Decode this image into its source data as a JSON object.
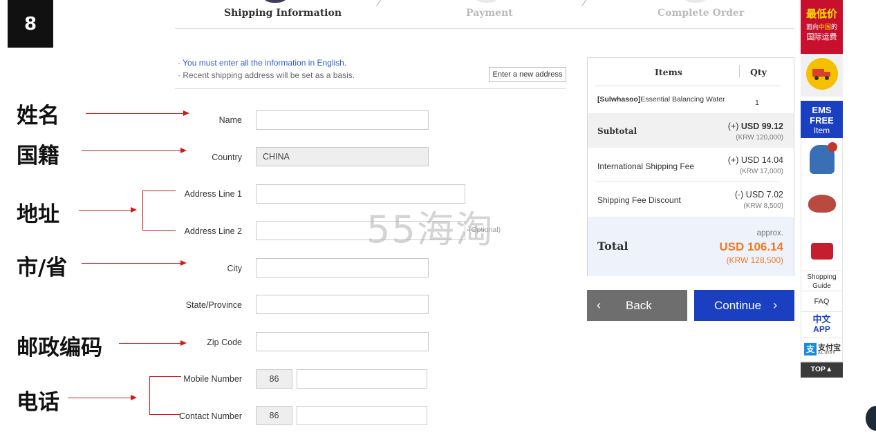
{
  "badge": "8",
  "steps": [
    "Shipping Information",
    "Payment",
    "Complete Order"
  ],
  "notes": {
    "english": "· You must enter all the information in English.",
    "recent": "· Recent shipping address will be set as a basis."
  },
  "new_address_label": "Enter a new address",
  "form": {
    "name_label": "Name",
    "country_label": "Country",
    "country_value": "CHINA",
    "address1_label": "Address Line 1",
    "address2_label": "Address Line 2",
    "optional": "(Optional)",
    "city_label": "City",
    "state_label": "State/Province",
    "zip_label": "Zip Code",
    "mobile_label": "Mobile Number",
    "mobile_code": "86",
    "contact_label": "Contact Number",
    "contact_code": "86"
  },
  "annotations": {
    "name": "姓名",
    "country": "国籍",
    "address": "地址",
    "city": "市/省",
    "zip": "邮政编码",
    "phone": "电话"
  },
  "summary": {
    "items_header": "Items",
    "qty_header": "Qty",
    "item_brand": "[Sulwhasoo]",
    "item_name": "Essential Balancing Water",
    "item_qty": "1",
    "subtotal_label": "Subtotal",
    "subtotal_sign": "(+) ",
    "subtotal_usd": "USD 99.12",
    "subtotal_krw": "(KRW 120,000)",
    "shipping_label": "International Shipping Fee",
    "shipping_usd": "(+) USD 14.04",
    "shipping_krw": "(KRW 17,000)",
    "discount_label": "Shipping Fee Discount",
    "discount_usd": "(-) USD 7.02",
    "discount_krw": "(KRW 8,500)",
    "approx": "approx.",
    "total_label": "Total",
    "total_usd": "USD 106.14",
    "total_krw": "(KRW 128,500)"
  },
  "buttons": {
    "back": "Back",
    "continue": "Continue"
  },
  "sidebar": {
    "promo_line1": "最低价",
    "promo_line2a": "面向",
    "promo_line2b": "中国",
    "promo_line2c": "的",
    "promo_line3": "国际运费",
    "ems1": "EMS",
    "ems2": "FREE",
    "ems3": "Item",
    "guide": "Shopping Guide",
    "faq": "FAQ",
    "app1": "中文",
    "app2": "APP",
    "alipay": "支付宝",
    "alipay_sub": "ALIPAY",
    "top": "TOP▲"
  },
  "watermark": "55海淘",
  "colors": {
    "accent_blue": "#1a3fc0",
    "total_orange": "#f07820",
    "annotation_red": "#d81818",
    "promo_red": "#c8102e"
  }
}
